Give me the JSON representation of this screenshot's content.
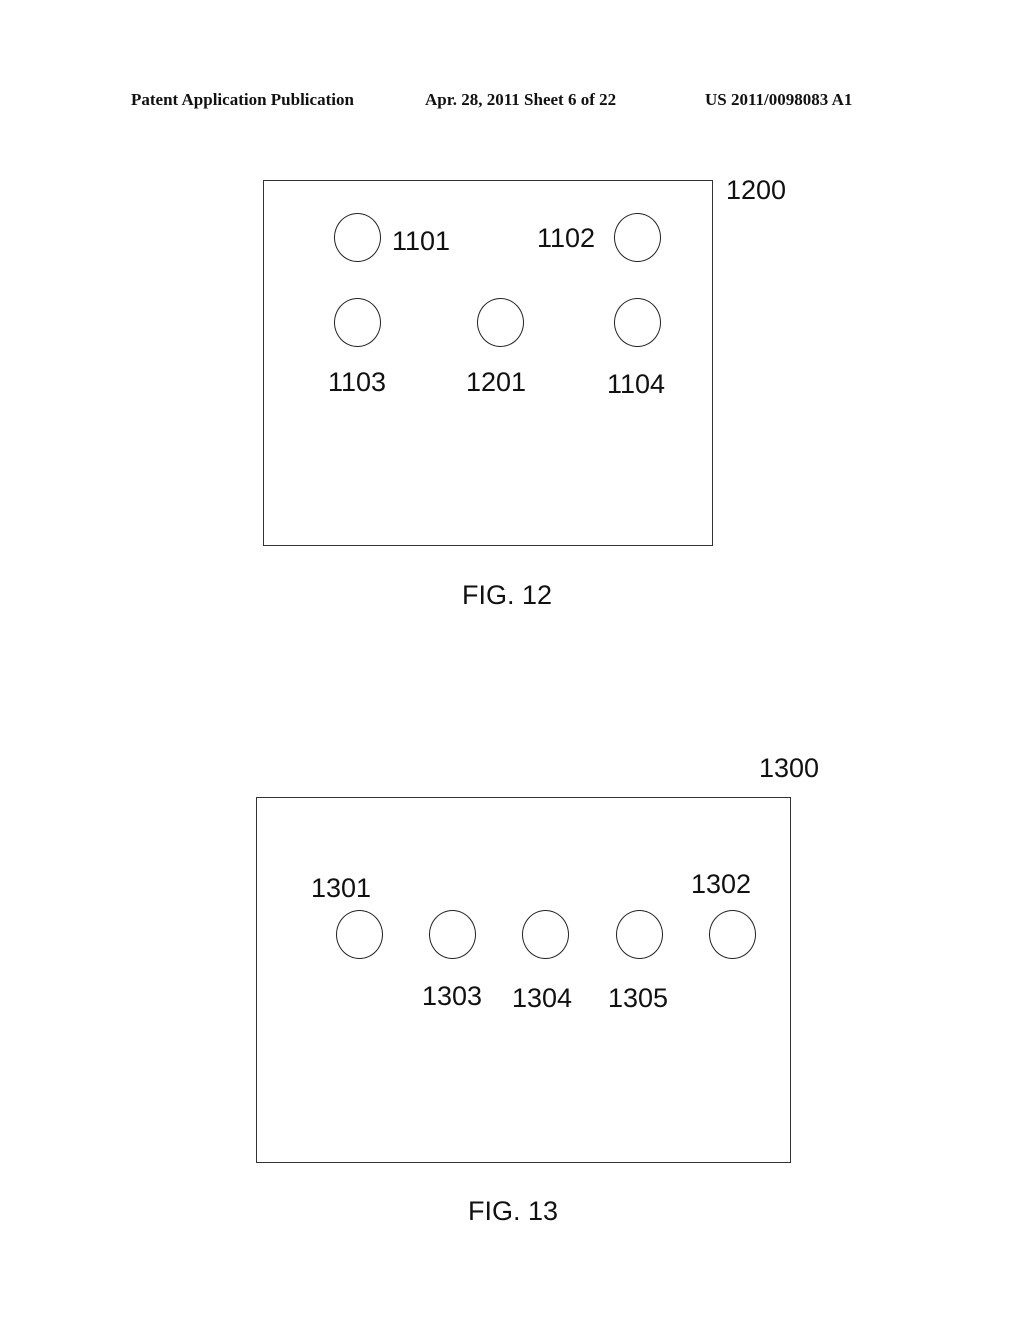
{
  "header": {
    "publication": "Patent Application Publication",
    "date_sheet": "Apr. 28, 2011  Sheet 6 of 22",
    "number": "US 2011/0098083 A1"
  },
  "fig12": {
    "ref": "1200",
    "caption": "FIG. 12",
    "labels": [
      "1101",
      "1102",
      "1103",
      "1201",
      "1104"
    ]
  },
  "fig13": {
    "ref": "1300",
    "caption": "FIG. 13",
    "labels": [
      "1301",
      "1302",
      "1303",
      "1304",
      "1305"
    ]
  }
}
